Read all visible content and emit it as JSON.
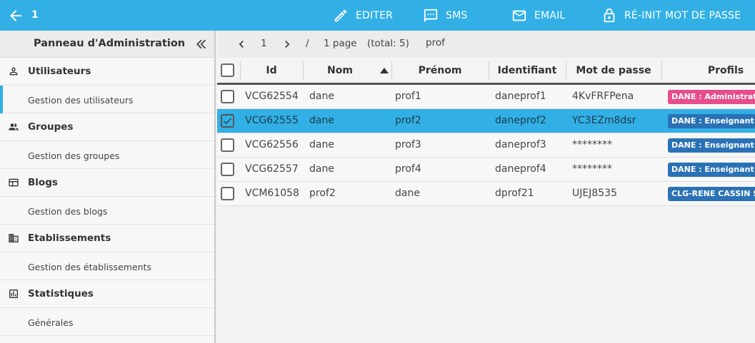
{
  "topbar": {
    "selected_count": "1",
    "actions": {
      "edit": "EDITER",
      "sms": "SMS",
      "email": "EMAIL",
      "reset_password": "RÉ-INIT MOT DE PASSE"
    },
    "background_color": "#32b0e6"
  },
  "sidebar": {
    "title": "Panneau d'Administration",
    "sections": [
      {
        "label": "Utilisateurs",
        "icon": "person-icon",
        "item": "Gestion des utilisateurs"
      },
      {
        "label": "Groupes",
        "icon": "group-icon",
        "item": "Gestion des groupes"
      },
      {
        "label": "Blogs",
        "icon": "blog-icon",
        "item": "Gestion des blogs"
      },
      {
        "label": "Etablissements",
        "icon": "building-icon",
        "item": "Gestion des établissements"
      },
      {
        "label": "Statistiques",
        "icon": "stats-icon",
        "item": "Générales"
      }
    ],
    "active_item": "Gestion des utilisateurs"
  },
  "pager": {
    "current_page": "1",
    "separator": "/",
    "page_info": "1 page",
    "total": "(total: 5)",
    "filter": "prof"
  },
  "table": {
    "columns": [
      "Id",
      "Nom",
      "Prénom",
      "Identifiant",
      "Mot de passe",
      "Profils"
    ],
    "sort_column": "Nom",
    "rows": [
      {
        "id": "VCG62554",
        "nom": "dane",
        "prenom": "prof1",
        "identifiant": "daneprof1",
        "password": "4KvFRFPena",
        "profil": "DANE : Administrateur",
        "badge_color": "#e64d8c",
        "checked": false
      },
      {
        "id": "VCG62555",
        "nom": "dane",
        "prenom": "prof2",
        "identifiant": "daneprof2",
        "password": "YC3EZm8dsr",
        "profil": "DANE : Enseignant",
        "badge_color": "#2a72b5",
        "checked": true
      },
      {
        "id": "VCG62556",
        "nom": "dane",
        "prenom": "prof3",
        "identifiant": "daneprof3",
        "password": "********",
        "profil": "DANE : Enseignant",
        "badge_color": "#2a72b5",
        "checked": false
      },
      {
        "id": "VCG62557",
        "nom": "dane",
        "prenom": "prof4",
        "identifiant": "daneprof4",
        "password": "********",
        "profil": "DANE : Enseignant",
        "badge_color": "#2a72b5",
        "checked": false
      },
      {
        "id": "VCM61058",
        "nom": "prof2",
        "prenom": "dane",
        "identifiant": "dprof21",
        "password": "UJEJ8535",
        "profil": "CLG-RENE CASSIN S",
        "badge_color": "#2a72b5",
        "checked": false
      }
    ]
  }
}
